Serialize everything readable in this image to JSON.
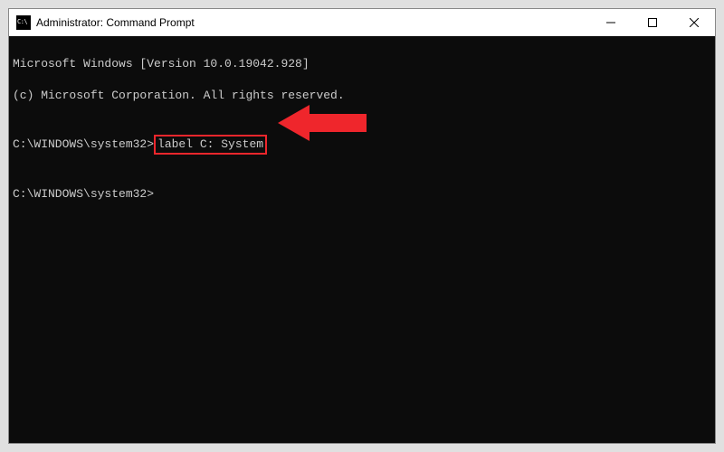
{
  "title": "Administrator: Command Prompt",
  "lines": {
    "l1": "Microsoft Windows [Version 10.0.19042.928]",
    "l2": "(c) Microsoft Corporation. All rights reserved.",
    "l3": "",
    "l4_prompt": "C:\\WINDOWS\\system32>",
    "l4_command": "label C: System",
    "l5": "",
    "l6": "C:\\WINDOWS\\system32>"
  },
  "annotation": {
    "arrow_color": "#ef262c"
  }
}
